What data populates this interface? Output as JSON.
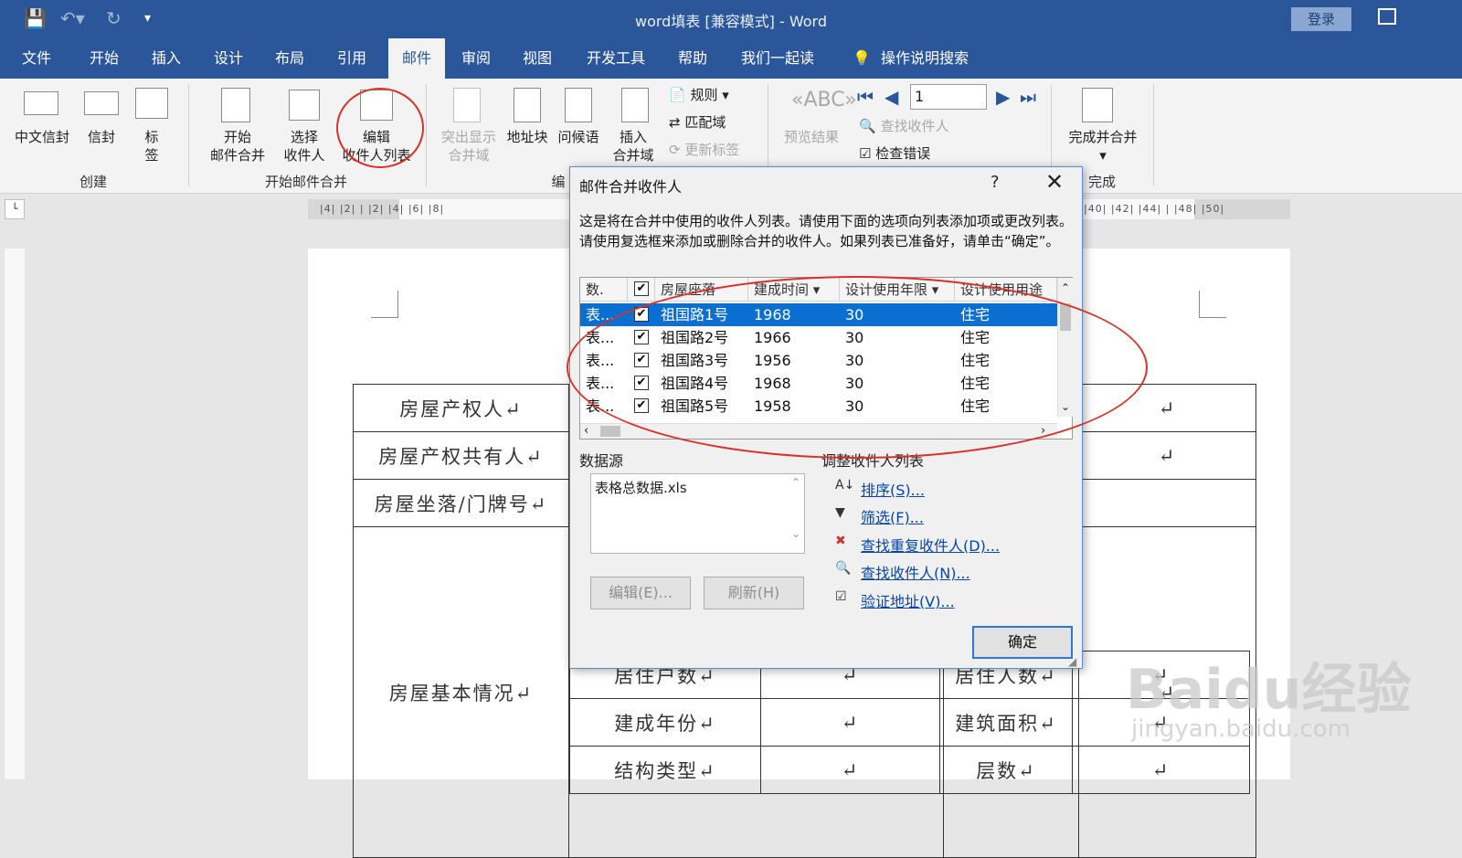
{
  "window": {
    "title": "word填表 [兼容模式] - Word",
    "login": "登录"
  },
  "tabs": [
    "文件",
    "开始",
    "插入",
    "设计",
    "布局",
    "引用",
    "邮件",
    "审阅",
    "视图",
    "开发工具",
    "帮助",
    "我们一起读",
    "操作说明搜索"
  ],
  "ribbon": {
    "create": {
      "label": "创建",
      "buttons": [
        "中文信封",
        "信封",
        "标\n签"
      ]
    },
    "start_merge": {
      "label": "开始邮件合并",
      "start": "开始\n邮件合并",
      "select": "选择\n收件人",
      "edit": "编辑\n收件人列表"
    },
    "write": {
      "label": "编",
      "highlight": "突出显示\n合并域",
      "address": "地址块",
      "greeting": "问候语",
      "insert": "插入\n合并域",
      "rules": "规则",
      "match": "匹配域",
      "update": "更新标签"
    },
    "preview": {
      "label": "预览结果",
      "record": "1",
      "find": "查找收件人",
      "check": "检查错误"
    },
    "finish": {
      "label": "完成",
      "button": "完成并合并"
    }
  },
  "ruler": "|4| |2| |  |2| |4| |6| |8| ",
  "ruler_right": "|40| |42| |44| |  |48| |50|",
  "document": {
    "rows": [
      "房屋产权人↵",
      "房屋产权共有人↵",
      "房屋坐落/门牌号↵",
      "房屋基本情况↵"
    ],
    "inner": [
      [
        "居住户数↵",
        "↵",
        "居住人数↵",
        "↵"
      ],
      [
        "建成年份↵",
        "↵",
        "建筑面积↵",
        "↵"
      ],
      [
        "结构类型↵",
        "↵",
        "层数↵",
        "↵"
      ]
    ],
    "mark": "↵"
  },
  "dialog": {
    "title": "邮件合并收件人",
    "help": "?",
    "close": "✕",
    "description": "这是将在合并中使用的收件人列表。请使用下面的选项向列表添加项或更改列表。请使用复选框来添加或删除合并的收件人。如果列表已准备好，请单击“确定”。",
    "columns": [
      "数.",
      "",
      "房屋座落",
      "建成时间",
      "设计使用年限",
      "设计使用用途"
    ],
    "records": [
      {
        "source": "表...",
        "checked": true,
        "address": "祖国路1号",
        "year": "1968",
        "life": "30",
        "use": "住宅"
      },
      {
        "source": "表...",
        "checked": true,
        "address": "祖国路2号",
        "year": "1966",
        "life": "30",
        "use": "住宅"
      },
      {
        "source": "表...",
        "checked": true,
        "address": "祖国路3号",
        "year": "1956",
        "life": "30",
        "use": "住宅"
      },
      {
        "source": "表...",
        "checked": true,
        "address": "祖国路4号",
        "year": "1968",
        "life": "30",
        "use": "住宅"
      },
      {
        "source": "表...",
        "checked": true,
        "address": "祖国路5号",
        "year": "1958",
        "life": "30",
        "use": "住宅"
      }
    ],
    "datasource_label": "数据源",
    "datasource_item": "表格总数据.xls",
    "adjust_label": "调整收件人列表",
    "edit_btn": "编辑(E)...",
    "refresh_btn": "刷新(H)",
    "links": [
      "排序(S)...",
      "筛选(F)...",
      "查找重复收件人(D)...",
      "查找收件人(N)...",
      "验证地址(V)..."
    ],
    "ok": "确定"
  },
  "watermark": {
    "main": "Baidu经验",
    "sub": "jingyan.baidu.com"
  },
  "colors": {
    "title_bar": "#2b579a",
    "selection": "#0a6fd1",
    "annotation": "#d9302c"
  }
}
